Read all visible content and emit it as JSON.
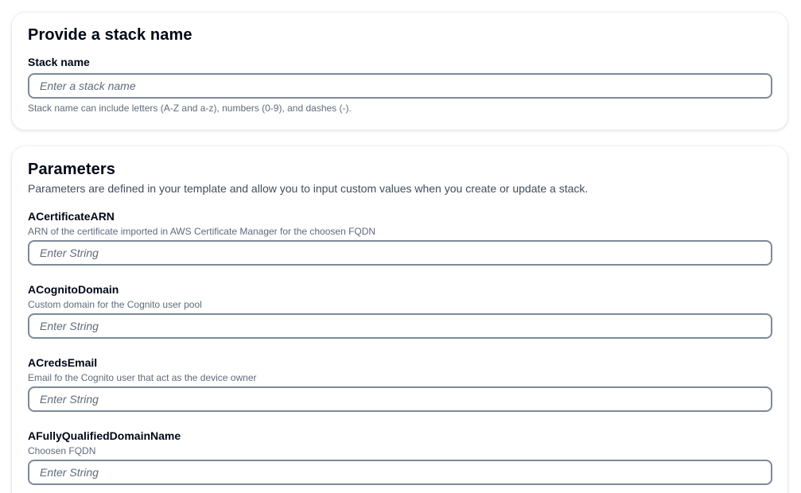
{
  "stack_section": {
    "title": "Provide a stack name",
    "field_label": "Stack name",
    "placeholder": "Enter a stack name",
    "constraint": "Stack name can include letters (A-Z and a-z), numbers (0-9), and dashes (-)."
  },
  "parameters_section": {
    "title": "Parameters",
    "description": "Parameters are defined in your template and allow you to input custom values when you create or update a stack.",
    "params": [
      {
        "label": "ACertificateARN",
        "description": "ARN of the certificate imported in AWS Certificate Manager for the choosen FQDN",
        "placeholder": "Enter String"
      },
      {
        "label": "ACognitoDomain",
        "description": "Custom domain for the Cognito user pool",
        "placeholder": "Enter String"
      },
      {
        "label": "ACredsEmail",
        "description": "Email fo the Cognito user that act as the device owner",
        "placeholder": "Enter String"
      },
      {
        "label": "AFullyQualifiedDomainName",
        "description": "Choosen FQDN",
        "placeholder": "Enter String"
      }
    ]
  },
  "colors": {
    "text_primary": "#000716",
    "text_secondary": "#5f6b7a",
    "input_border": "#7d8998"
  }
}
